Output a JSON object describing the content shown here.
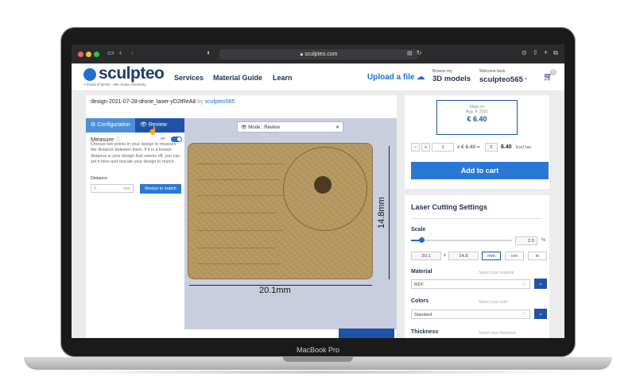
{
  "device": {
    "label": "MacBook Pro"
  },
  "browser": {
    "url": "sculpteo.com"
  },
  "header": {
    "logo": "sculpteo",
    "tagline": "A brand of BASF - We create chemistry",
    "nav": [
      "Services",
      "Material Guide",
      "Learn"
    ],
    "upload": "Upload a file",
    "browse_small": "Browse my",
    "browse_big": "3D models",
    "welcome_small": "Welcome back",
    "username": "sculpteo565",
    "cart_count": "0"
  },
  "design": {
    "title": "design-2021-07-28-drone_laser-yD2tReA8",
    "by": "by",
    "author": "sculpteo565",
    "tab_config": "Configuration",
    "tab_review": "Review",
    "mode_label": "Mode : Review",
    "measure_label": "Measure",
    "on_label": "on",
    "measure_help": "Choose two points in your design to measure the distance between them. If it is a known distance in your design that seems off, you can set it here and rescale your design to match.",
    "distance_label": "Distance",
    "distance_value": "0",
    "distance_unit": "mm",
    "resize_button": "Resize to match",
    "width_dim": "20.1mm",
    "height_dim": "14.8mm"
  },
  "order": {
    "ships_on": "Ships on",
    "ship_date": "Aug. 4, 2021",
    "price": "€ 6.40",
    "qty": "1",
    "unit_price_text": "x € 6.40 =",
    "currency": "€",
    "total": "6.40",
    "excl_tax": "Excl tax",
    "add_to_cart": "Add to cart"
  },
  "settings": {
    "title": "Laser Cutting Settings",
    "scale_label": "Scale",
    "scale_value": "2.0",
    "scale_unit": "%",
    "dim_x": "20.1",
    "dim_x_sep": "x",
    "dim_y": "14.8",
    "unit_mm": "mm",
    "unit_cm": "cm",
    "unit_in": "in",
    "material_label": "Material",
    "material_placeholder": "Select your material",
    "material_value": "MDF",
    "colors_label": "Colors",
    "color_placeholder": "Select your color",
    "color_value": "Standard",
    "thickness_label": "Thickness",
    "thickness_placeholder": "Select your thickness"
  }
}
